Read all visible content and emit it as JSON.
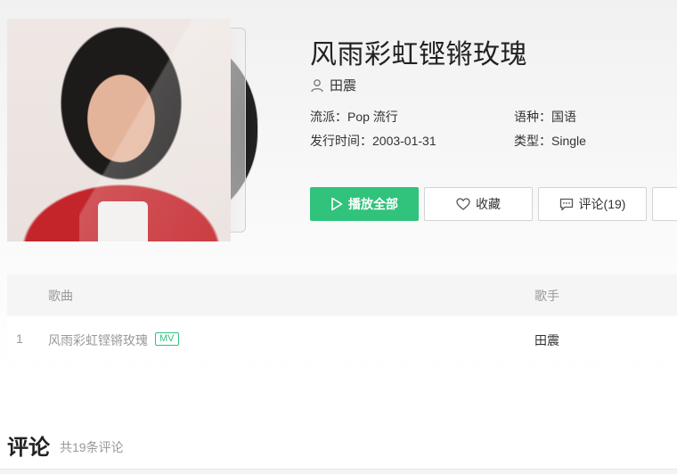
{
  "album": {
    "title": "风雨彩虹铿锵玫瑰",
    "singer": "田震",
    "genre": "流派：Pop 流行",
    "language": "语种：国语",
    "release_date": "发行时间：2003-01-31",
    "type": "类型：Single"
  },
  "actions": {
    "play_all": "播放全部",
    "favorite": "收藏",
    "comment": "评论(19)"
  },
  "song_list": {
    "headers": {
      "song": "歌曲",
      "singer": "歌手"
    },
    "rows": [
      {
        "index": "1",
        "name": "风雨彩虹铿锵玫瑰",
        "badge": "MV",
        "singer": "田震"
      }
    ]
  },
  "comments": {
    "title": "评论",
    "count_text": "共19条评论"
  },
  "colors": {
    "accent": "#31c27c",
    "text": "#333333",
    "muted": "#999999"
  },
  "icons": [
    "user-icon",
    "play-icon",
    "heart-icon",
    "comment-icon"
  ]
}
